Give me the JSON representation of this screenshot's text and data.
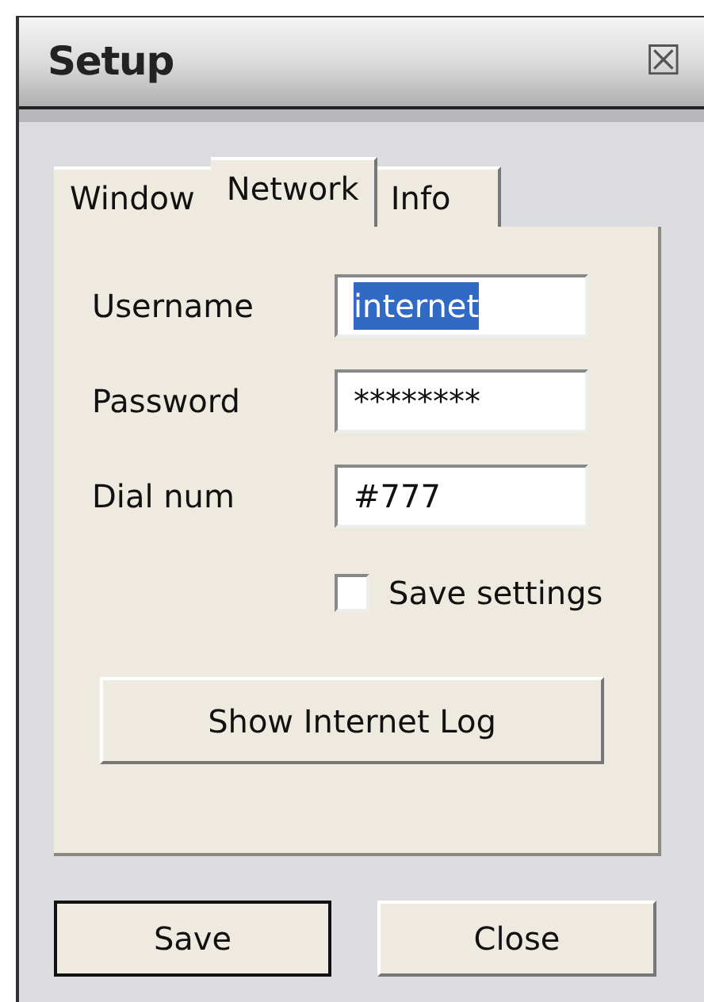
{
  "window": {
    "title": "Setup",
    "close": "☒"
  },
  "tabs": [
    {
      "label": "Window",
      "selected": false
    },
    {
      "label": "Network",
      "selected": true
    },
    {
      "label": "Info",
      "selected": false
    }
  ],
  "fields": [
    {
      "label": "Username",
      "value": "internet",
      "text_selected": true
    },
    {
      "label": "Password",
      "value": "********",
      "text_selected": false
    },
    {
      "label": "Dial num",
      "value": "#777",
      "text_selected": false
    }
  ],
  "save_settings": {
    "label": "Save settings",
    "checked": false
  },
  "log_button": "Show Internet Log",
  "buttons": [
    {
      "label": "Save",
      "default": true
    },
    {
      "label": "Close",
      "default": false
    }
  ]
}
